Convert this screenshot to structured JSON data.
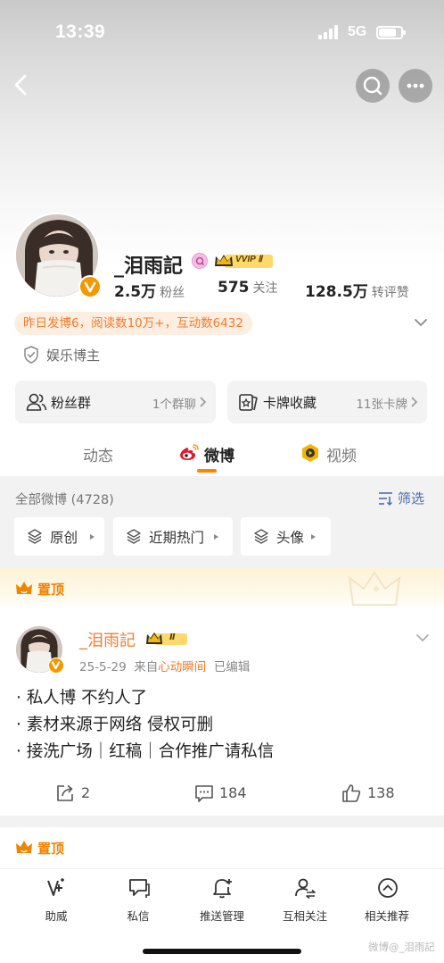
{
  "status_bar": {
    "time": "13:39",
    "network": "5G"
  },
  "colors": {
    "accent": "#ff8200",
    "orange_text": "#f07d2d",
    "link_blue": "#4a6ea8",
    "gold": "#f39800"
  },
  "profile": {
    "name": "_泪雨記",
    "vip_badge": "VVIP Ⅱ",
    "stats": [
      {
        "value": "2.5万",
        "label": "粉丝"
      },
      {
        "value": "575",
        "label": "关注"
      },
      {
        "value": "128.5万",
        "label": "转评赞"
      }
    ],
    "highlight": "昨日发博6，阅读数10万+，互动数6432",
    "tag": "娱乐博主"
  },
  "cards": [
    {
      "title": "粉丝群",
      "sub": "1个群聊",
      "icon": "fans-group-icon"
    },
    {
      "title": "卡牌收藏",
      "sub": "11张卡牌",
      "icon": "card-collection-icon"
    }
  ],
  "tabs": [
    {
      "label": "动态",
      "active": false
    },
    {
      "label": "微博",
      "active": true
    },
    {
      "label": "视频",
      "active": false
    }
  ],
  "feed_header": {
    "all_label": "全部微博 (4728)",
    "filter_label": "筛选",
    "chips": [
      "原创",
      "近期热门",
      "头像"
    ]
  },
  "pinned_label": "置顶",
  "post": {
    "author": "_泪雨記",
    "vip_small": "Ⅱ",
    "date": "25-5-29",
    "from_prefix": "来自",
    "source": "心动瞬间",
    "edited": "已编辑",
    "lines": [
      "· 私人博 不约人了",
      "· 素材来源于网络 侵权可删",
      "· 接洗广场｜红稿｜合作推广请私信"
    ],
    "reposts": "2",
    "comments": "184",
    "likes": "138"
  },
  "pinned_label_2": "置顶",
  "bottom_nav": [
    {
      "label": "助威",
      "icon": "cheer-icon"
    },
    {
      "label": "私信",
      "icon": "message-icon"
    },
    {
      "label": "推送管理",
      "icon": "bell-plus-icon"
    },
    {
      "label": "互相关注",
      "icon": "mutual-follow-icon"
    },
    {
      "label": "相关推荐",
      "icon": "related-chevron-icon"
    }
  ],
  "watermark": "微博@_泪雨記"
}
